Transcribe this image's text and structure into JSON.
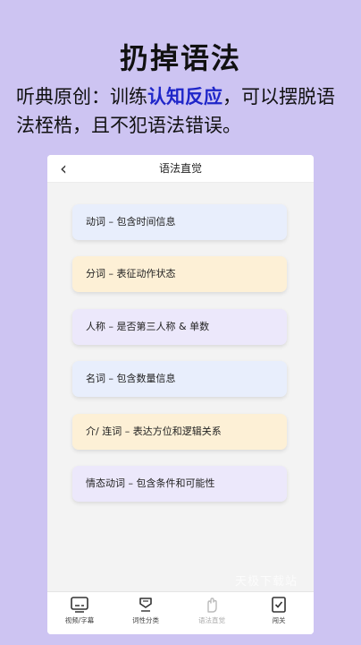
{
  "promo": {
    "headline": "扔掉语法",
    "sub_before": "听典原创：训练",
    "sub_highlight": "认知反应",
    "sub_after": "，可以摆脱语法桎梏，且不犯语法错误。"
  },
  "nav": {
    "back_glyph": "‹",
    "title": "语法直觉"
  },
  "cards": [
    "动词 – 包含时间信息",
    "分词 – 表征动作状态",
    "人称 – 是否第三人称 & 单数",
    "名词 – 包含数量信息",
    "介/ 连词 – 表达方位和逻辑关系",
    "情态动词 – 包含条件和可能性"
  ],
  "tabs": [
    {
      "label": "视频/字幕",
      "icon": "video-subtitle-icon"
    },
    {
      "label": "词性分类",
      "icon": "category-icon"
    },
    {
      "label": "语法直觉",
      "icon": "hand-icon"
    },
    {
      "label": "闯关",
      "icon": "checklist-icon"
    }
  ],
  "watermark": "天极下载站"
}
